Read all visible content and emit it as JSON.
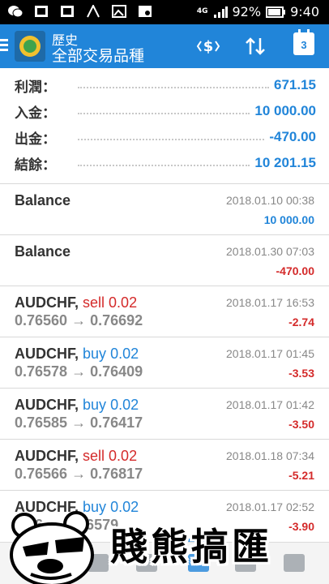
{
  "status_bar": {
    "network": "4G",
    "battery": "92%",
    "time": "9:40"
  },
  "toolbar": {
    "title": "歷史",
    "subtitle": "全部交易品種",
    "calendar_day": "3"
  },
  "summary": [
    {
      "label": "利潤：",
      "value": "671.15"
    },
    {
      "label": "入金：",
      "value": "10 000.00"
    },
    {
      "label": "出金：",
      "value": "-470.00"
    },
    {
      "label": "結餘：",
      "value": "10 201.15"
    }
  ],
  "items": [
    {
      "symbol": "Balance",
      "action": "",
      "volume": "",
      "prices": "",
      "date": "2018.01.10 00:38",
      "profit": "10 000.00",
      "positive": true
    },
    {
      "symbol": "Balance",
      "action": "",
      "volume": "",
      "prices": "",
      "date": "2018.01.30 07:03",
      "profit": "-470.00",
      "positive": false
    },
    {
      "symbol": "AUDCHF,",
      "action": "sell",
      "volume": "0.02",
      "prices": "0.76560 → 0.76692",
      "date": "2018.01.17 16:53",
      "profit": "-2.74",
      "positive": false
    },
    {
      "symbol": "AUDCHF,",
      "action": "buy",
      "volume": "0.02",
      "prices": "0.76578 → 0.76409",
      "date": "2018.01.17 01:45",
      "profit": "-3.53",
      "positive": false
    },
    {
      "symbol": "AUDCHF,",
      "action": "buy",
      "volume": "0.02",
      "prices": "0.76585 → 0.76417",
      "date": "2018.01.17 01:42",
      "profit": "-3.50",
      "positive": false
    },
    {
      "symbol": "AUDCHF,",
      "action": "sell",
      "volume": "0.02",
      "prices": "0.76566 → 0.76817",
      "date": "2018.01.18 07:34",
      "profit": "-5.21",
      "positive": false
    },
    {
      "symbol": "AUDCHF,",
      "action": "buy",
      "volume": "0.02",
      "prices": "0.76 → 0.76579",
      "date": "2018.01.17 02:52",
      "profit": "-3.90",
      "positive": false
    }
  ],
  "watermark": "賤熊搞匯",
  "colors": {
    "accent": "#2185d9",
    "negative": "#d42a2a"
  }
}
